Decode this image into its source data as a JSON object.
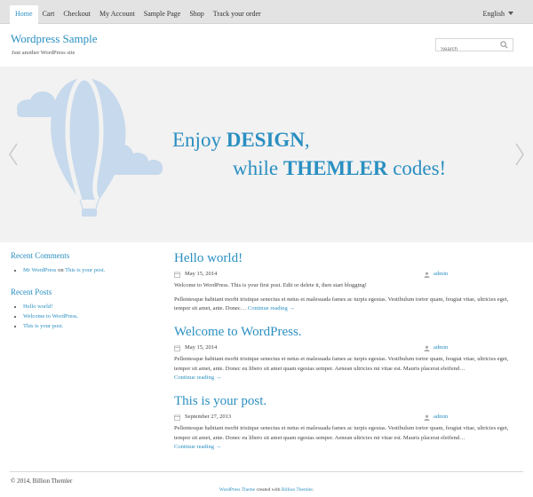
{
  "nav": {
    "items": [
      {
        "label": "Home",
        "active": true
      },
      {
        "label": "Cart",
        "active": false
      },
      {
        "label": "Checkout",
        "active": false
      },
      {
        "label": "My Account",
        "active": false
      },
      {
        "label": "Sample Page",
        "active": false
      },
      {
        "label": "Shop",
        "active": false
      },
      {
        "label": "Track your order",
        "active": false
      }
    ],
    "language": "English"
  },
  "header": {
    "site_title": "Wordpress Sample",
    "tagline": "Just another WordPress site",
    "search_placeholder": "Search"
  },
  "hero": {
    "line1_pre": "Enjoy ",
    "line1_bold": "DESIGN",
    "line1_post": ",",
    "line2_pre": "while ",
    "line2_bold": "THEMLER",
    "line2_post": " codes!"
  },
  "sidebar": {
    "recent_comments_title": "Recent Comments",
    "comment": {
      "author": "Mr WordPress",
      "on": "on",
      "post": "This is your post."
    },
    "recent_posts_title": "Recent Posts",
    "recent_posts": [
      "Hello world!",
      "Welcome to WordPress.",
      "This is your post."
    ]
  },
  "posts": [
    {
      "title": "Hello world!",
      "date": "May 15, 2014",
      "author": "admin",
      "text": "Welcome to WordPress. This is your first post. Edit or delete it, then start blogging!",
      "text2": "Pellentesque habitant morbi tristique senectus et netus et malesuada fames ac turpis egestas. Vestibulum tortor quam, feugiat vitae, ultricies eget, tempor sit amet, ante. Donec…",
      "more": "Continue reading →"
    },
    {
      "title": "Welcome to WordPress.",
      "date": "May 15, 2014",
      "author": "admin",
      "text": "Pellentesque habitant morbi tristique senectus et netus et malesuada fames ac turpis egestas. Vestibulum tortor quam, feugiat vitae, ultricies eget, tempor sit amet, ante. Donec eu libero sit amet quam egestas semper. Aenean ultricies mi vitae est. Mauris placerat eleifend…",
      "more": "Continue reading →"
    },
    {
      "title": "This is your post.",
      "date": "September 27, 2013",
      "author": "admin",
      "text": "Pellentesque habitant morbi tristique senectus et netus et malesuada fames ac turpis egestas. Vestibulum tortor quam, feugiat vitae, ultricies eget, tempor sit amet, ante. Donec eu libero sit amet quam egestas semper. Aenean ultricies mi vitae est. Mauris placerat eleifend…",
      "more": "Continue reading →"
    }
  ],
  "footer": {
    "copyright": "© 2014, Billion Themler",
    "credit_pre": "WordPress Theme",
    "credit_mid": " created with ",
    "credit_link": "Billion Themler",
    "credit_post": "."
  },
  "colors": {
    "accent": "#2a8fc1",
    "nav_bg": "#e3e3e3",
    "hero_bg": "#f2f2f2",
    "balloon": "#c7d9ec"
  }
}
